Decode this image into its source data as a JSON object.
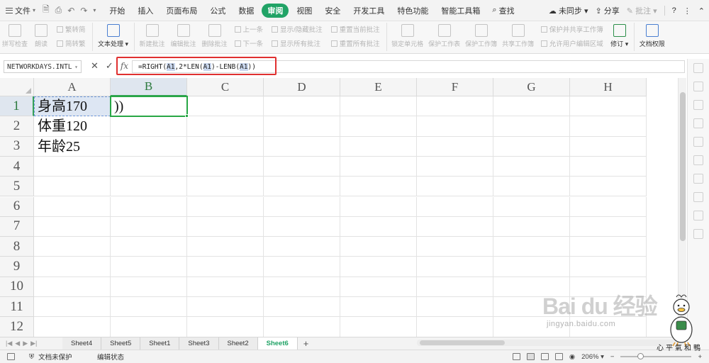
{
  "menubar": {
    "file_label": "文件",
    "tabs": [
      "开始",
      "插入",
      "页面布局",
      "公式",
      "数据",
      "审阅",
      "视图",
      "安全",
      "开发工具",
      "特色功能",
      "智能工具箱"
    ],
    "active_tab": "审阅",
    "search_label": "查找",
    "sync_label": "未同步",
    "share_label": "分享",
    "comment_label": "批注",
    "help": "?"
  },
  "ribbon": {
    "spellcheck": "拼写检查",
    "read": "朗读",
    "trad_to_simp": "繁转简",
    "simp_to_trad": "简转繁",
    "text_process": "文本处理",
    "new_comment": "新建批注",
    "edit_comment": "编辑批注",
    "delete_comment": "删除批注",
    "prev": "上一条",
    "next": "下一条",
    "show_hide_comment": "显示/隐藏批注",
    "show_all_comments": "显示所有批注",
    "reset_current_comment": "重置当前批注",
    "reset_all_comments": "重置所有批注",
    "lock_cell": "锁定单元格",
    "protect_sheet": "保护工作表",
    "protect_workbook": "保护工作簿",
    "share_workbook": "共享工作簿",
    "protect_share_workbook": "保护并共享工作簿",
    "allow_edit_ranges": "允许用户编辑区域",
    "revision": "修订",
    "doc_permission": "文档权限"
  },
  "formula_bar": {
    "name_box": "NETWORKDAYS.INTL",
    "fx": "fx",
    "formula_parts": [
      "=RIGHT(",
      "A1",
      ",2*LEN(",
      "A1",
      ")-LENB(",
      "A1",
      "))"
    ]
  },
  "columns": [
    "A",
    "B",
    "C",
    "D",
    "E",
    "F",
    "G",
    "H"
  ],
  "rows": [
    "1",
    "2",
    "3",
    "4",
    "5",
    "6",
    "7",
    "8",
    "9",
    "10",
    "11",
    "12"
  ],
  "cells": {
    "A1": "身高170",
    "A2": "体重120",
    "A3": "年龄25",
    "B1": "))"
  },
  "sheets": [
    "Sheet4",
    "Sheet5",
    "Sheet1",
    "Sheet3",
    "Sheet2",
    "Sheet6"
  ],
  "active_sheet": "Sheet6",
  "status": {
    "protect": "文档未保护",
    "mode": "编辑状态",
    "zoom": "206%"
  },
  "watermark": {
    "logo": "Bai du 经验",
    "url": "jingyan.baidu.com",
    "duck_text": "心平氣和鴨"
  },
  "colors": {
    "accent_green": "#21a366",
    "highlight_red": "#e03030",
    "ref_blue": "#c9d7ee"
  }
}
